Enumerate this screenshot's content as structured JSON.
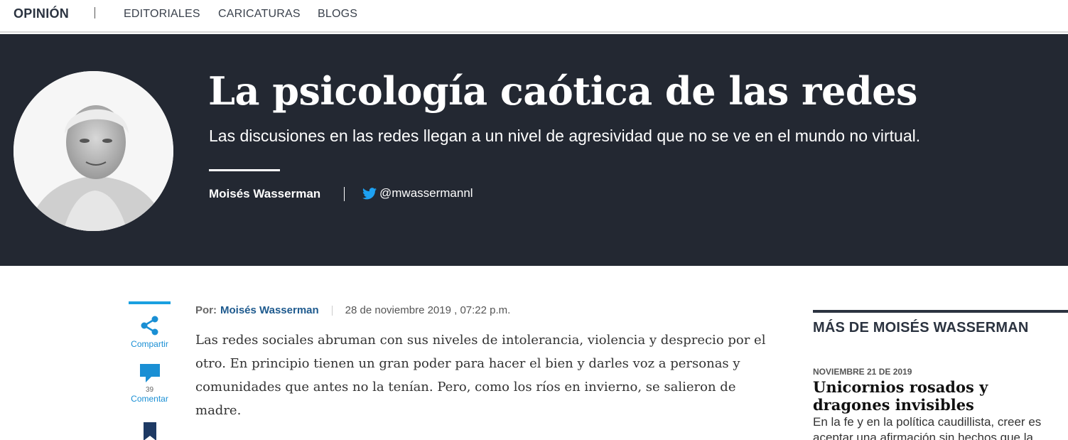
{
  "nav": {
    "section": "OPINIÓN",
    "links": [
      "EDITORIALES",
      "CARICATURAS",
      "BLOGS"
    ]
  },
  "hero": {
    "title": "La psicología caótica de las redes",
    "subtitle": "Las discusiones en las redes llegan a un nivel de agresividad que no se ve en el mundo no virtual.",
    "author": "Moisés Wasserman",
    "twitter_handle": "@mwassermannl",
    "background_color": "#232832"
  },
  "rail": {
    "share_label": "Compartir",
    "comment_count": "39",
    "comment_label": "Comentar",
    "accent_color": "#1aa0e0"
  },
  "article": {
    "by_label": "Por:",
    "author": "Moisés Wasserman",
    "date": "28 de noviembre 2019 , 07:22 p.m.",
    "paragraph": "Las redes sociales abruman con sus niveles de intolerancia, violencia y desprecio por el otro. En principio tienen un gran poder para hacer el bien y darles voz a personas y comunidades que antes no la tenían. Pero, como los ríos en invierno, se salieron de madre."
  },
  "sidebar": {
    "heading": "MÁS DE MOISÉS WASSERMAN",
    "item": {
      "date": "NOVIEMBRE 21 DE 2019",
      "title": "Unicornios rosados y dragones invisibles",
      "description": "En la fe y en la política caudillista, creer es aceptar una afirmación sin hechos que la"
    }
  }
}
